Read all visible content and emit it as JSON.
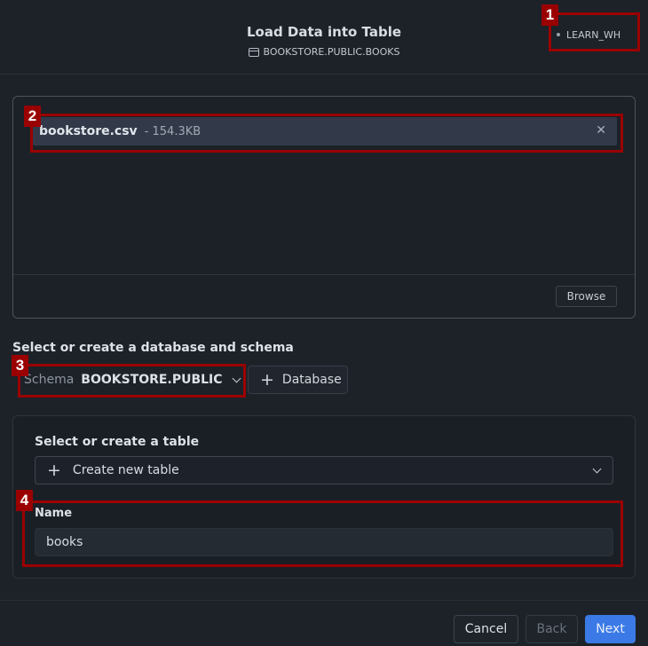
{
  "header": {
    "title": "Load Data into Table",
    "subtitle": "BOOKSTORE.PUBLIC.BOOKS",
    "subtitle_icon": "table-icon",
    "warehouse": "LEARN_WH"
  },
  "upload": {
    "file_name": "bookstore.csv",
    "file_size": "- 154.3KB",
    "remove_icon": "close-icon",
    "browse_label": "Browse"
  },
  "database_section": {
    "label": "Select or create a database and schema",
    "schema_prefix": "Schema",
    "schema_value": "BOOKSTORE.PUBLIC",
    "add_database_label": "Database"
  },
  "table_section": {
    "label": "Select or create a table",
    "selected_option": "Create new table",
    "name_label": "Name",
    "name_value": "books"
  },
  "footer": {
    "cancel_label": "Cancel",
    "back_label": "Back",
    "next_label": "Next"
  },
  "annotations": [
    "1",
    "2",
    "3",
    "4"
  ],
  "colors": {
    "accent": "#3b7ae6",
    "annotation": "#9b0000",
    "background": "#1d2229"
  }
}
